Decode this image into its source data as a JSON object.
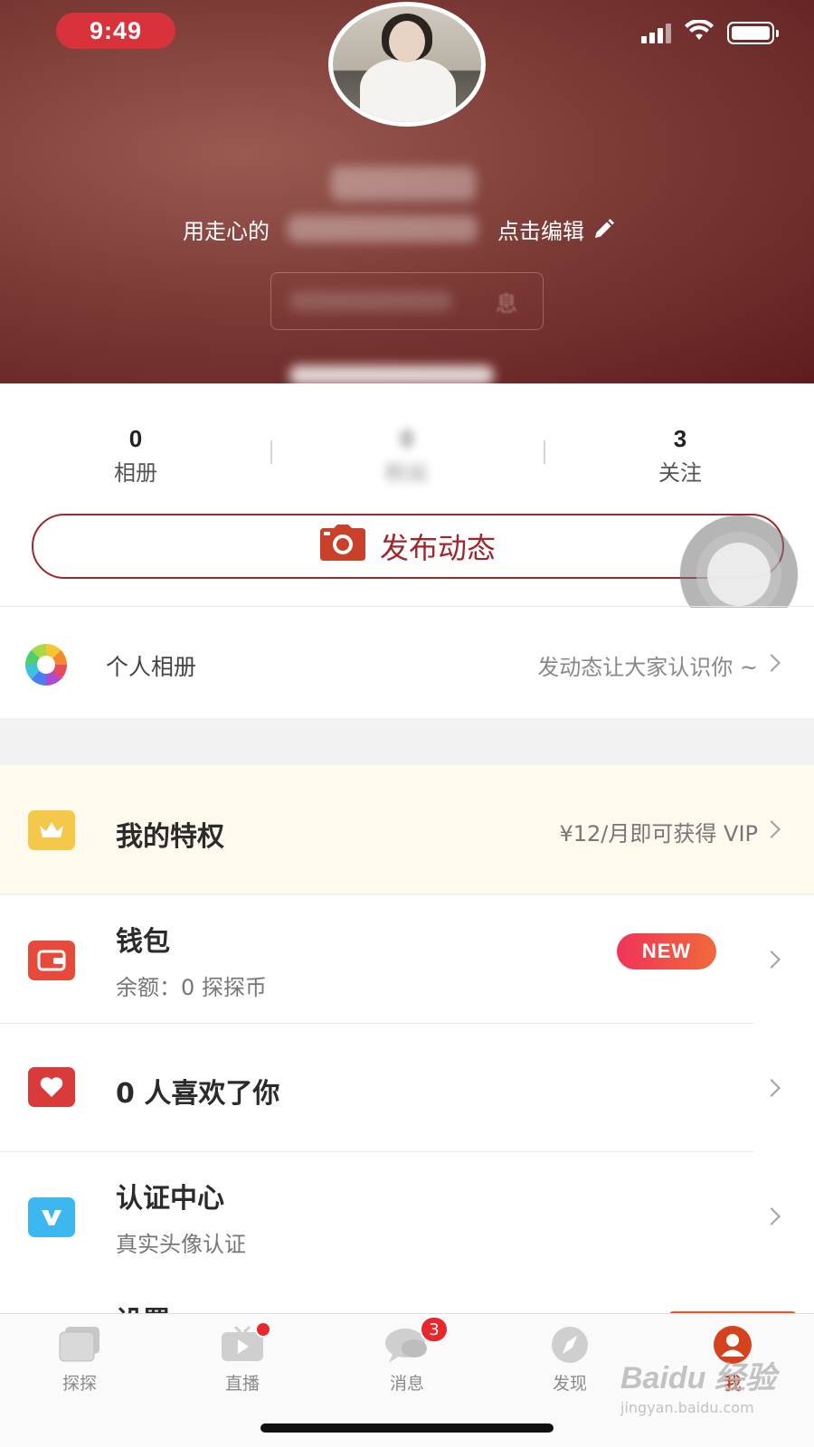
{
  "status": {
    "time": "9:49"
  },
  "profile": {
    "bio_prefix": "用走心的",
    "edit_label": "点击编辑",
    "ghost_button_tail": "息"
  },
  "stats": [
    {
      "value": "0",
      "label": "相册"
    },
    {
      "value": "0",
      "label": "粉丝"
    },
    {
      "value": "3",
      "label": "关注"
    }
  ],
  "publish": {
    "label": "发布动态"
  },
  "album": {
    "title": "个人相册",
    "hint": "发动态让大家认识你 ~"
  },
  "rows": {
    "vip": {
      "title": "我的特权",
      "right": "¥12/月即可获得 VIP",
      "color": "#f5c84a"
    },
    "wallet": {
      "title": "钱包",
      "sub": "余额：0 探探币",
      "badge": "NEW",
      "color": "#e64a3b"
    },
    "likes": {
      "title": "0 人喜欢了你",
      "color": "#d93a3a"
    },
    "verify": {
      "title": "认证中心",
      "sub": "真实头像认证",
      "color": "#3db7f0"
    },
    "peek": {
      "title": "设置"
    }
  },
  "tabs": [
    {
      "label": "探探",
      "icon": "cards-icon"
    },
    {
      "label": "直播",
      "icon": "live-tv-icon"
    },
    {
      "label": "消息",
      "icon": "chat-bubble-icon",
      "badge": "3"
    },
    {
      "label": "发现",
      "icon": "compass-icon"
    },
    {
      "label": "我",
      "icon": "profile-icon",
      "active": true
    }
  ],
  "watermark": {
    "main": "Baidu 经验",
    "sub": "jingyan.baidu.com"
  },
  "colors": {
    "accent": "#a3252b",
    "header": "#7e3c37",
    "active_tab": "#c23a20"
  }
}
